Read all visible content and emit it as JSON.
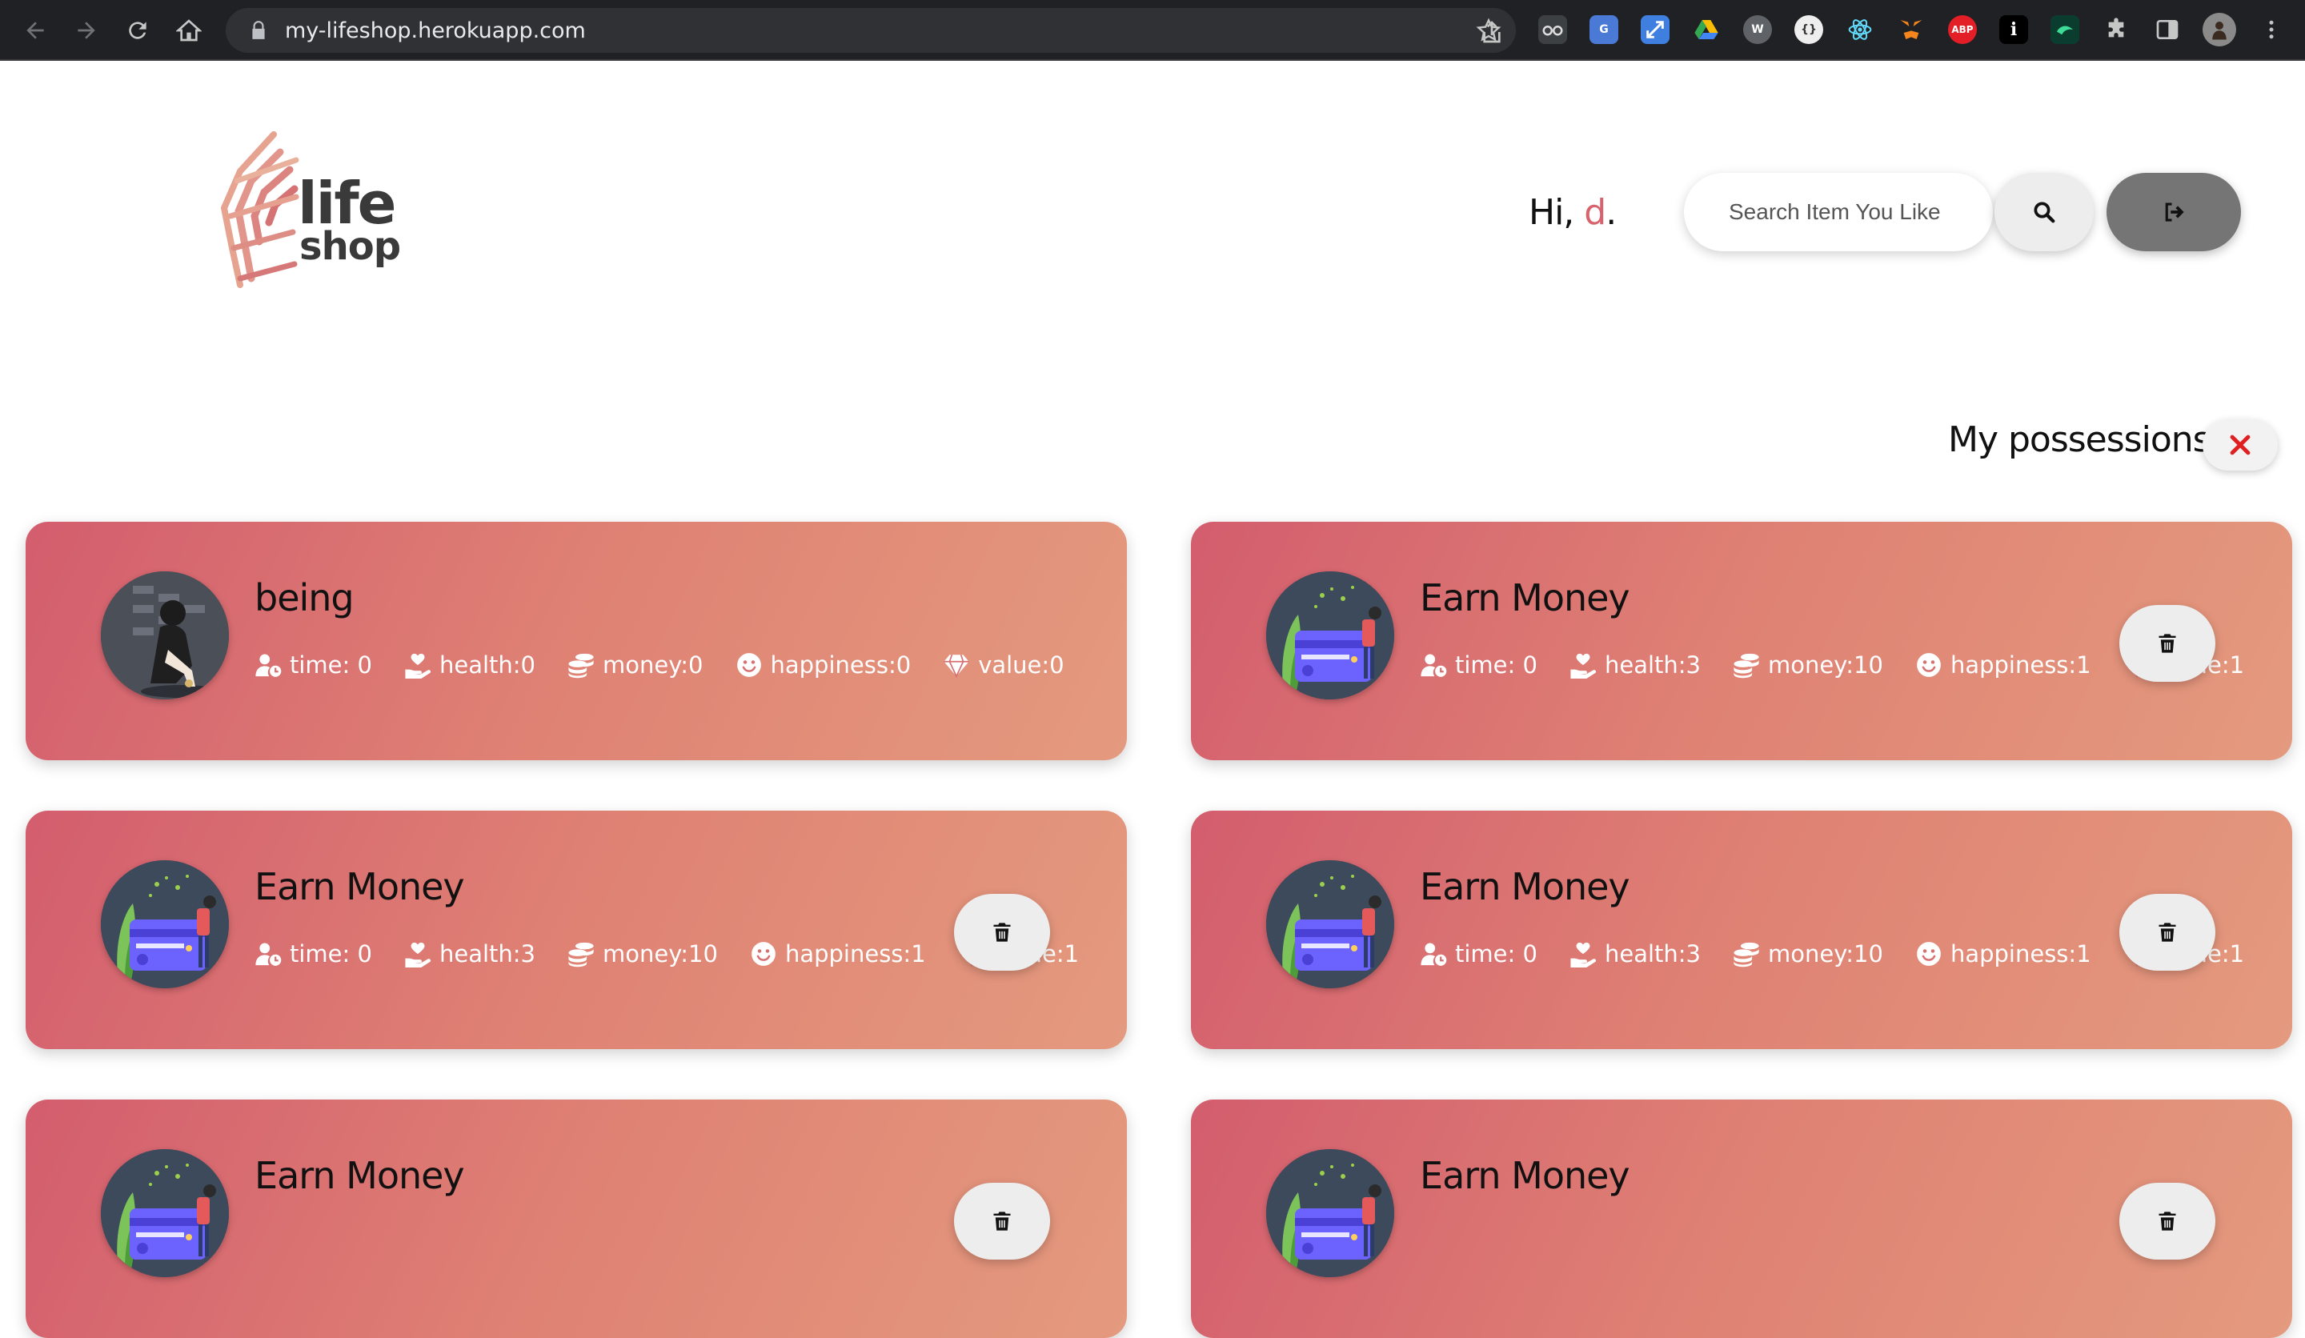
{
  "browser": {
    "url": "my-lifeshop.herokuapp.com",
    "extensions": [
      "reader-icon",
      "translate-icon",
      "resize-icon",
      "drive-icon",
      "w-icon",
      "json-icon",
      "react-icon",
      "metamask-icon",
      "adblock-icon",
      "info-icon",
      "terminal-icon",
      "puzzle-icon",
      "sidepanel-icon",
      "profile-avatar",
      "menu-icon"
    ],
    "adblock_label": "ABP",
    "info_label": "i"
  },
  "header": {
    "logo_line1": "life",
    "logo_line2": "shop",
    "greeting_prefix": "Hi, ",
    "username": "d",
    "greeting_suffix": ".",
    "search_placeholder": "Search Item You Like"
  },
  "section": {
    "title": "My possessions"
  },
  "colors": {
    "accent": "#d6636e",
    "card_gradient_start": "#d35d6e",
    "card_gradient_end": "#e49a7e",
    "close_icon": "#e02020"
  },
  "possessions": [
    {
      "title": "being",
      "image": "person-sitting",
      "time": "time: 0",
      "health": "health:0",
      "money": "money:0",
      "happiness": "happiness:0",
      "value": "value:0",
      "deletable": false
    },
    {
      "title": "Earn Money",
      "image": "card-illustration",
      "time": "time: 0",
      "health": "health:3",
      "money": "money:10",
      "happiness": "happiness:1",
      "value": "value:1",
      "deletable": true
    },
    {
      "title": "Earn Money",
      "image": "card-illustration",
      "time": "time: 0",
      "health": "health:3",
      "money": "money:10",
      "happiness": "happiness:1",
      "value": "value:1",
      "deletable": true
    },
    {
      "title": "Earn Money",
      "image": "card-illustration",
      "time": "time: 0",
      "health": "health:3",
      "money": "money:10",
      "happiness": "happiness:1",
      "value": "value:1",
      "deletable": true
    },
    {
      "title": "Earn Money",
      "image": "card-illustration",
      "time": "",
      "health": "",
      "money": "",
      "happiness": "",
      "value": "",
      "deletable": true
    },
    {
      "title": "Earn Money",
      "image": "card-illustration",
      "time": "",
      "health": "",
      "money": "",
      "happiness": "",
      "value": "",
      "deletable": true
    }
  ]
}
